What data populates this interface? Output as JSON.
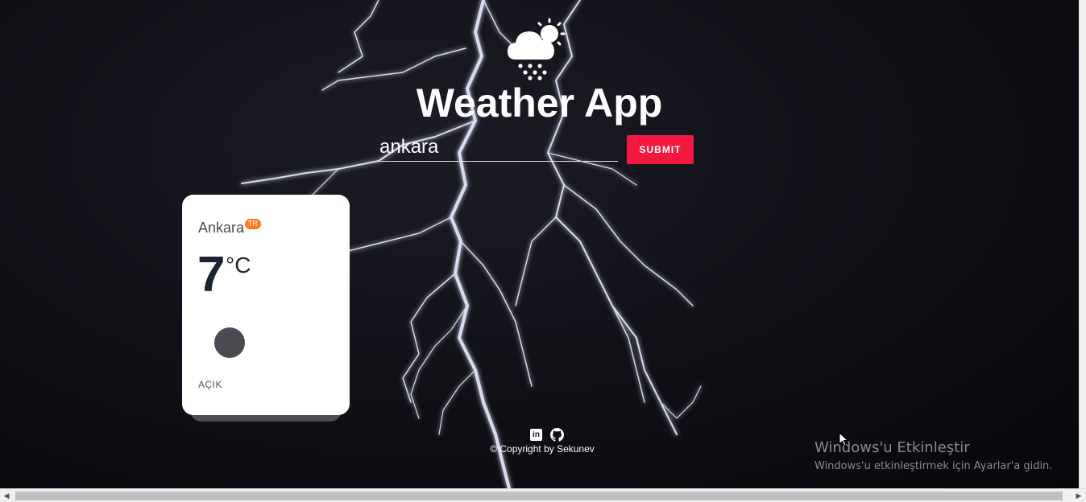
{
  "app": {
    "title": "Weather App"
  },
  "search": {
    "value": "ankara",
    "submit_label": "SUBMIT"
  },
  "weather_card": {
    "city": "Ankara",
    "country": "TR",
    "temperature": "7",
    "unit": "°C",
    "description": "AÇIK",
    "icon": "weather-condition-icon"
  },
  "footer": {
    "linkedin_glyph": "in",
    "copyright": "© Copyright by Sekunev"
  },
  "windows_watermark": {
    "title": "Windows'u Etkinleştir",
    "subtitle": "Windows'u etkinleştirmek için Ayarlar'a gidin."
  },
  "scrollbar": {
    "left_arrow": "◀",
    "right_arrow": "▶"
  },
  "colors": {
    "accent": "#f2183f",
    "badge": "#ff7a1a",
    "background": "#0c0c12",
    "card": "#ffffff"
  }
}
